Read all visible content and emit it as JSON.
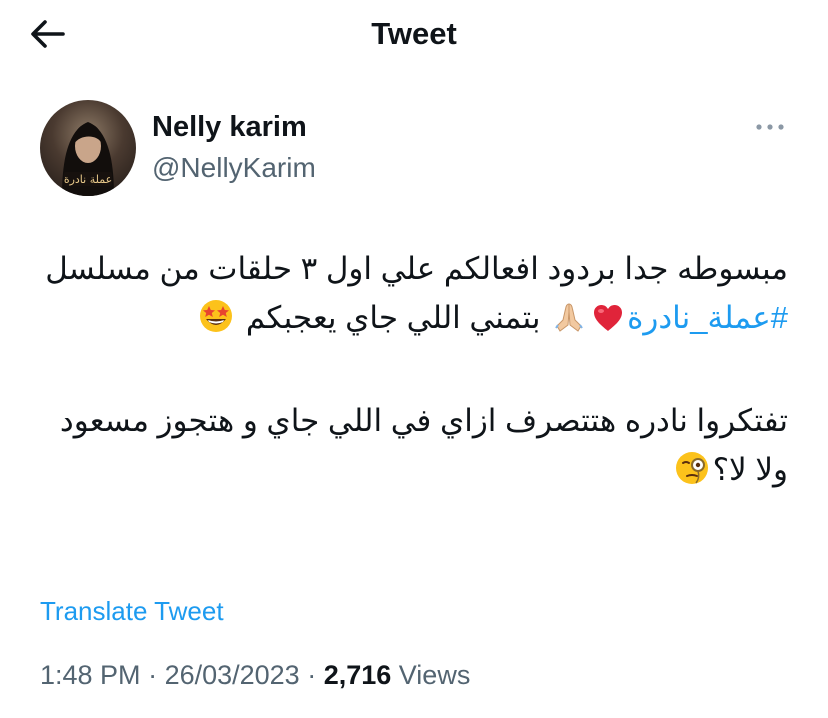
{
  "header": {
    "back_icon": "arrow-left-icon",
    "title": "Tweet"
  },
  "author": {
    "name": "Nelly karim",
    "handle": "@NellyKarim",
    "avatar_caption": "عملة نادرة"
  },
  "more_icon": "more-horizontal-icon",
  "tweet": {
    "line1": "مبسوطه جدا بردود افعالكم علي اول ٣ حلقات من",
    "line2_start": "مسلسل",
    "hashtag": "#عملة_نادرة",
    "heart_emoji": "❤️",
    "pray_emoji": "🙏🏼",
    "line2_end": "بتمني اللي جاي يعجبكم",
    "star_struck_emoji": "🤩",
    "para2": "تفتكروا نادره هتتصرف ازاي في اللي جاي و هتجوز مسعود ولا لا؟",
    "monocle_emoji": "🧐"
  },
  "translate_label": "Translate Tweet",
  "meta": {
    "time": "1:48 PM",
    "separator": " · ",
    "date": "26/03/2023",
    "views_count": "2,716",
    "views_label": " Views"
  },
  "colors": {
    "link": "#1d9bf0",
    "secondary_text": "#536471",
    "primary_text": "#0f1419"
  }
}
